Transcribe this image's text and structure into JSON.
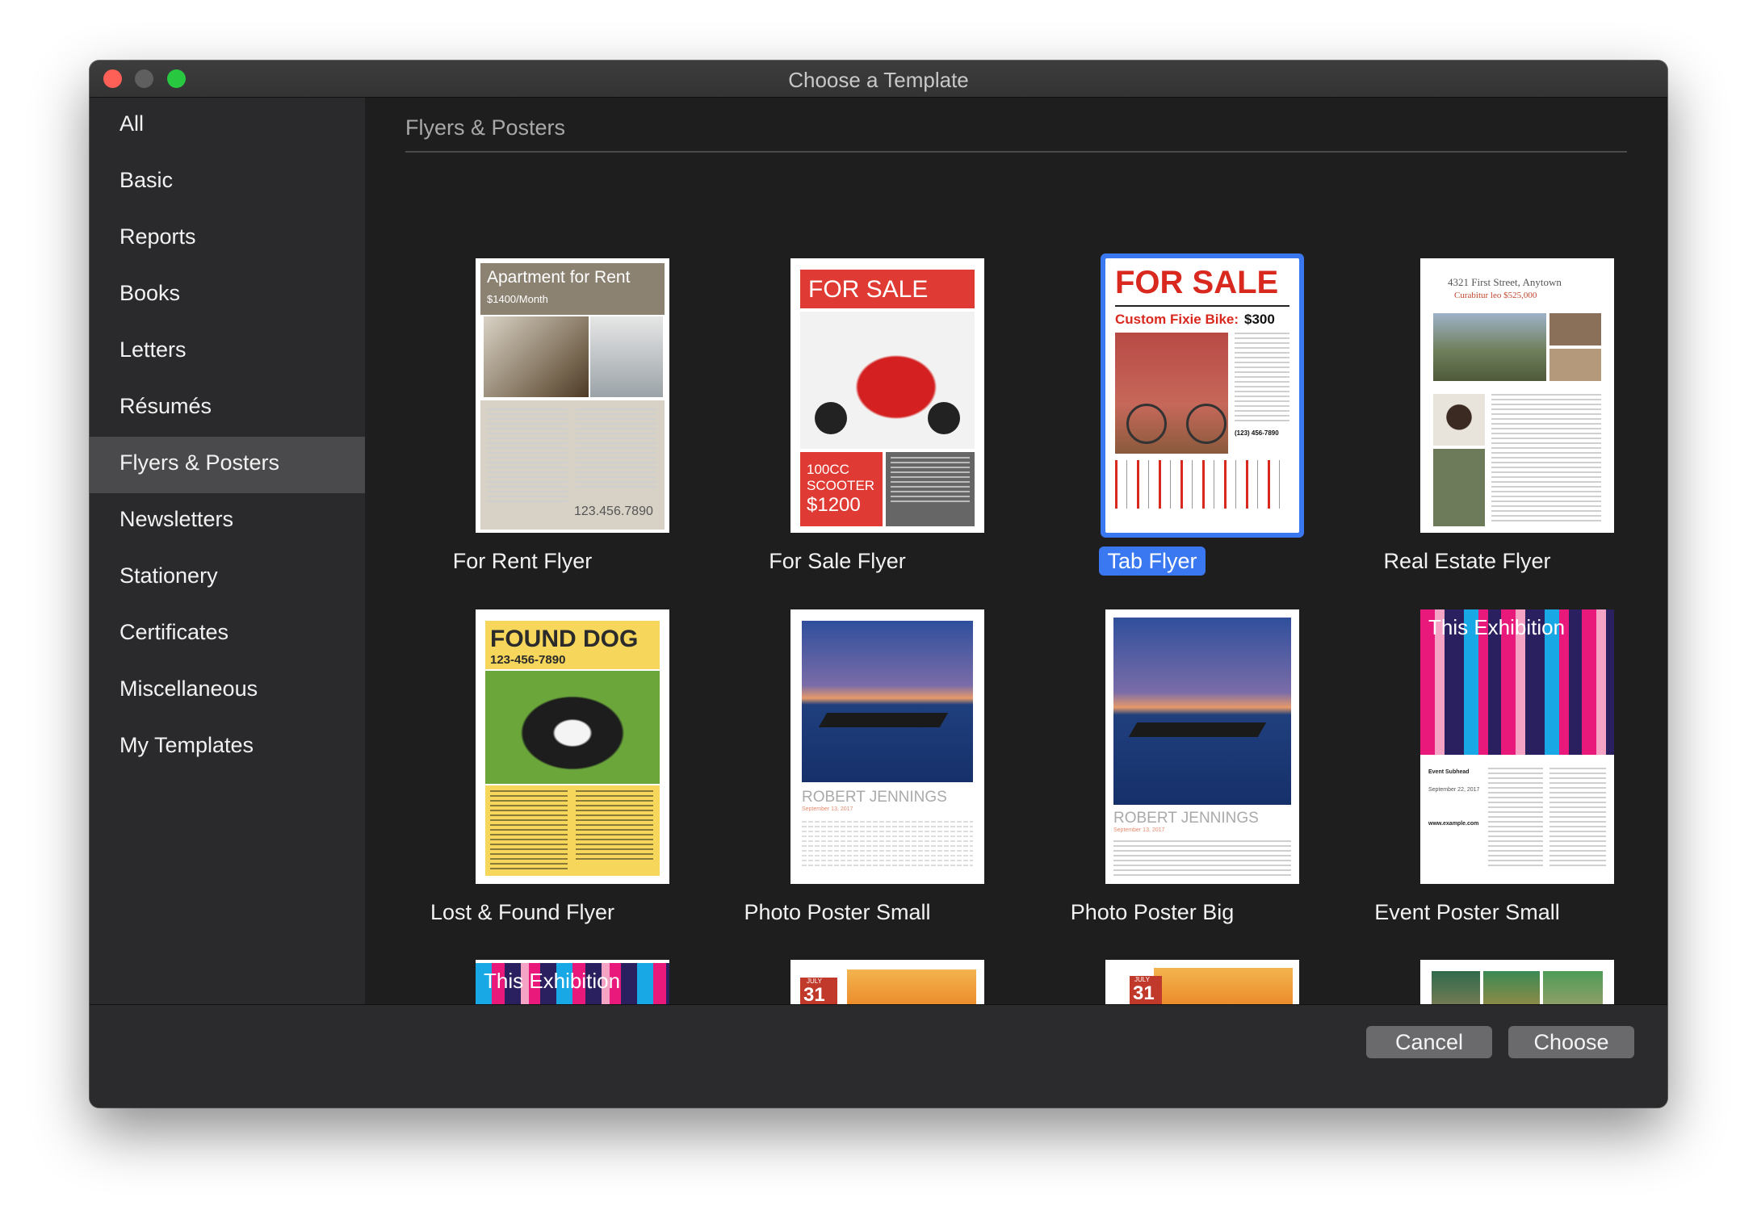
{
  "window": {
    "title": "Choose a Template"
  },
  "sidebar": {
    "items": [
      {
        "label": "All"
      },
      {
        "label": "Basic"
      },
      {
        "label": "Reports"
      },
      {
        "label": "Books"
      },
      {
        "label": "Letters"
      },
      {
        "label": "Résumés"
      },
      {
        "label": "Flyers & Posters",
        "selected": true
      },
      {
        "label": "Newsletters"
      },
      {
        "label": "Stationery"
      },
      {
        "label": "Certificates"
      },
      {
        "label": "Miscellaneous"
      },
      {
        "label": "My Templates"
      }
    ]
  },
  "main": {
    "section_title": "Flyers & Posters",
    "templates": [
      {
        "label": "For Rent Flyer",
        "thumb": {
          "heading": "Apartment for Rent",
          "subheading": "$1400/Month",
          "phone": "123.456.7890"
        }
      },
      {
        "label": "For Sale Flyer",
        "thumb": {
          "heading": "FOR SALE",
          "line1": "100CC",
          "line2": "SCOOTER",
          "price": "$1200"
        }
      },
      {
        "label": "Tab Flyer",
        "selected": true,
        "thumb": {
          "heading": "FOR SALE",
          "subheading": "Custom Fixie Bike:",
          "price": "$300",
          "phone": "(123) 456-7890"
        }
      },
      {
        "label": "Real Estate Flyer",
        "thumb": {
          "heading": "4321 First Street, Anytown",
          "subheading": "Curabitur leo $525,000"
        }
      },
      {
        "label": "Lost & Found Flyer",
        "thumb": {
          "heading": "FOUND DOG",
          "phone": "123-456-7890"
        }
      },
      {
        "label": "Photo Poster Small",
        "thumb": {
          "name": "ROBERT JENNINGS",
          "date": "September 13, 2017"
        }
      },
      {
        "label": "Photo Poster Big",
        "thumb": {
          "name": "ROBERT JENNINGS",
          "date": "September 13, 2017"
        }
      },
      {
        "label": "Event Poster Small",
        "thumb": {
          "heading": "This Exhibition",
          "subhead": "Event Subhead",
          "date": "September 22, 2017",
          "url": "www.example.com"
        }
      },
      {
        "label": "",
        "thumb": {
          "heading": "This Exhibition"
        }
      },
      {
        "label": "",
        "thumb": {
          "month": "JULY",
          "day": "31"
        }
      },
      {
        "label": "",
        "thumb": {
          "month": "JULY",
          "day": "31"
        }
      },
      {
        "label": "",
        "thumb": {}
      }
    ]
  },
  "footer": {
    "cancel_label": "Cancel",
    "choose_label": "Choose"
  },
  "colors": {
    "selection_blue": "#3a78f2",
    "close_red": "#fe5f57",
    "zoom_green": "#28c840"
  }
}
